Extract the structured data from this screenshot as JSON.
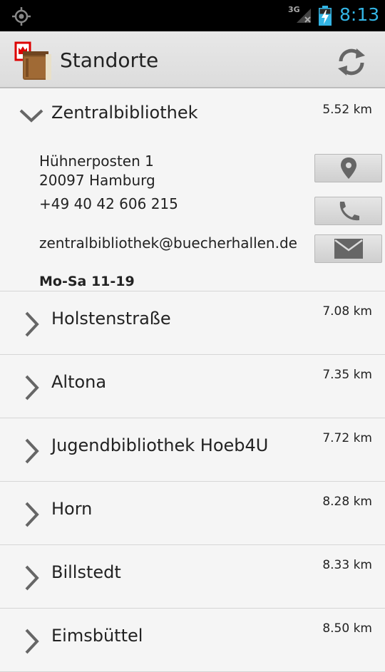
{
  "statusbar": {
    "network": "3G",
    "time": "8:13"
  },
  "actionbar": {
    "title": "Standorte",
    "logo_icon": "library-books-icon",
    "refresh_icon": "refresh-icon"
  },
  "expanded": {
    "name": "Zentralbibliothek",
    "distance": "5.52 km",
    "street": "Hühnerposten 1",
    "city": "20097 Hamburg",
    "phone": "+49 40 42 606 215",
    "email": "zentralbibliothek@buecherhallen.de",
    "hours": "Mo-Sa 11-19"
  },
  "locations": [
    {
      "name": "Holstenstraße",
      "distance": "7.08 km"
    },
    {
      "name": "Altona",
      "distance": "7.35 km"
    },
    {
      "name": "Jugendbibliothek Hoeb4U",
      "distance": "7.72 km"
    },
    {
      "name": "Horn",
      "distance": "8.28 km"
    },
    {
      "name": "Billstedt",
      "distance": "8.33 km"
    },
    {
      "name": "Eimsbüttel",
      "distance": "8.50 km"
    }
  ]
}
